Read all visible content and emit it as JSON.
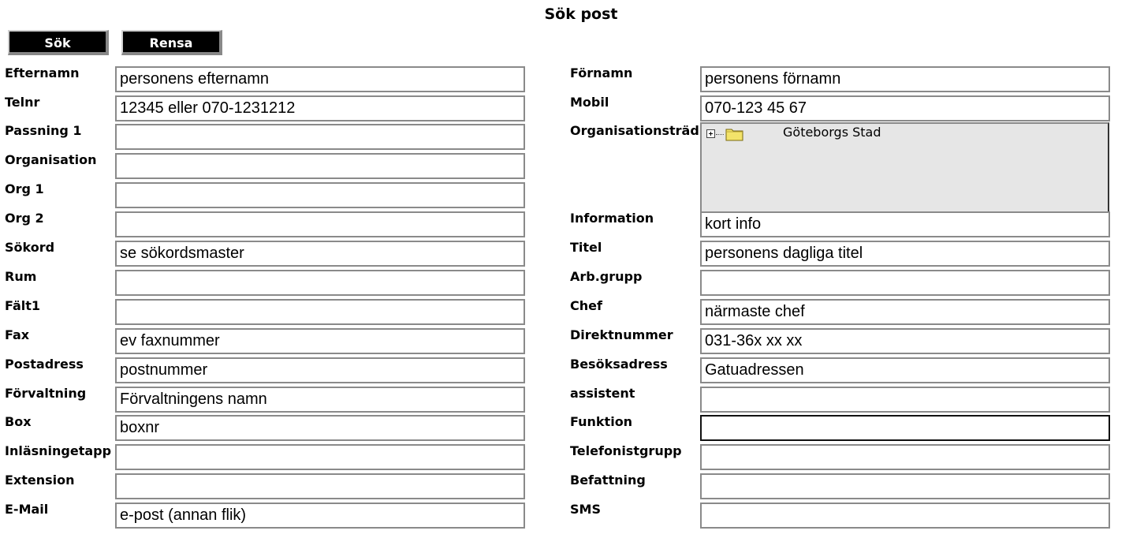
{
  "title": "Sök post",
  "buttons": {
    "search": "Sök",
    "clear": "Rensa"
  },
  "left_fields": [
    {
      "label": "Efternamn",
      "value": "personens efternamn"
    },
    {
      "label": "Telnr",
      "value": "12345 eller 070-1231212"
    },
    {
      "label": "Passning 1",
      "value": ""
    },
    {
      "label": "Organisation",
      "value": ""
    },
    {
      "label": "Org 1",
      "value": ""
    },
    {
      "label": "Org 2",
      "value": ""
    },
    {
      "label": "Sökord",
      "value": "se sökordsmaster"
    },
    {
      "label": "Rum",
      "value": ""
    },
    {
      "label": "Fält1",
      "value": ""
    },
    {
      "label": "Fax",
      "value": "ev faxnummer"
    },
    {
      "label": "Postadress",
      "value": "postnummer"
    },
    {
      "label": "Förvaltning",
      "value": "Förvaltningens namn"
    },
    {
      "label": "Box",
      "value": "boxnr"
    },
    {
      "label": "Inläsningetapp",
      "value": ""
    },
    {
      "label": "Extension",
      "value": ""
    },
    {
      "label": "E-Mail",
      "value": "e-post (annan flik)"
    }
  ],
  "right_fields": {
    "fornamn": {
      "label": "Förnamn",
      "value": "personens förnamn"
    },
    "mobil": {
      "label": "Mobil",
      "value": "070-123 45 67"
    },
    "org_tree": {
      "label": "Organisationsträd",
      "root": "Göteborgs Stad",
      "icon": "folder-icon"
    },
    "information": {
      "label": "Information",
      "value": "kort info"
    },
    "titel": {
      "label": "Titel",
      "value": "personens dagliga titel"
    },
    "arbgrupp": {
      "label": "Arb.grupp",
      "value": ""
    },
    "chef": {
      "label": "Chef",
      "value": "närmaste chef"
    },
    "direktnummer": {
      "label": "Direktnummer",
      "value": "031-36x xx xx"
    },
    "besoksadress": {
      "label": "Besöksadress",
      "value": "Gatuadressen"
    },
    "assistent": {
      "label": "assistent",
      "value": ""
    },
    "funktion": {
      "label": "Funktion",
      "value": ""
    },
    "telefonistgrupp": {
      "label": "Telefonistgrupp",
      "value": ""
    },
    "befattning": {
      "label": "Befattning",
      "value": ""
    },
    "sms": {
      "label": "SMS",
      "value": ""
    }
  }
}
